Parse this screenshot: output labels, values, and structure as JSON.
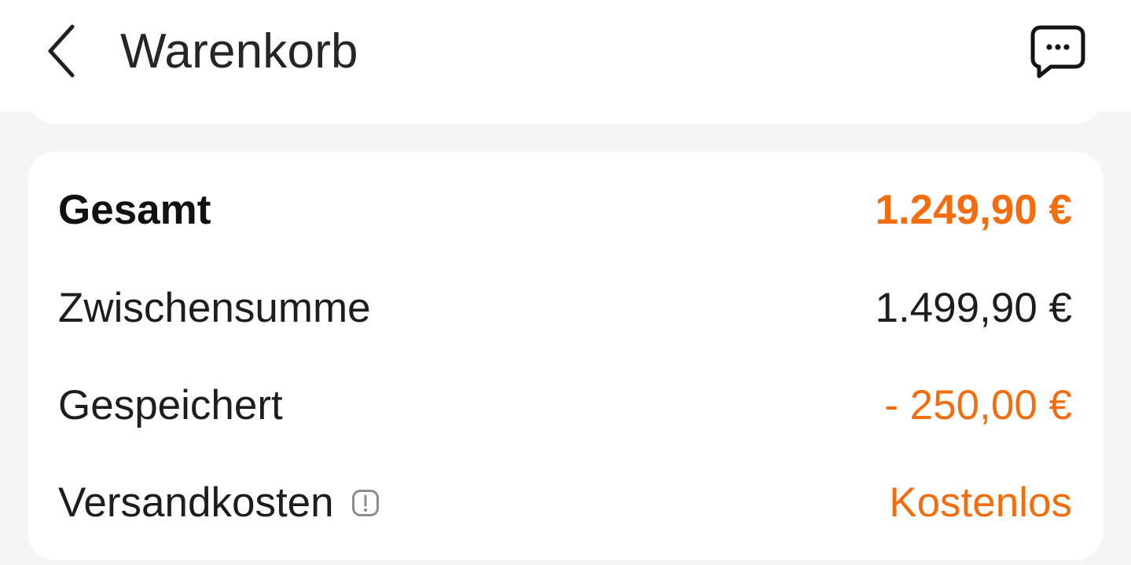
{
  "header": {
    "title": "Warenkorb",
    "back_icon": "chevron-left-icon",
    "menu_icon": "message-more-icon"
  },
  "summary": {
    "total_label": "Gesamt",
    "total_value": "1.249,90 €",
    "subtotal_label": "Zwischensumme",
    "subtotal_value": "1.499,90 €",
    "saved_label": "Gespeichert",
    "saved_value": "- 250,00 €",
    "shipping_label": "Versandkosten",
    "shipping_value": "Kostenlos",
    "info_icon": "info-icon"
  },
  "colors": {
    "accent": "#f36d0c",
    "text": "#1d1d1d",
    "background": "#f5f5f5",
    "card": "#ffffff"
  }
}
